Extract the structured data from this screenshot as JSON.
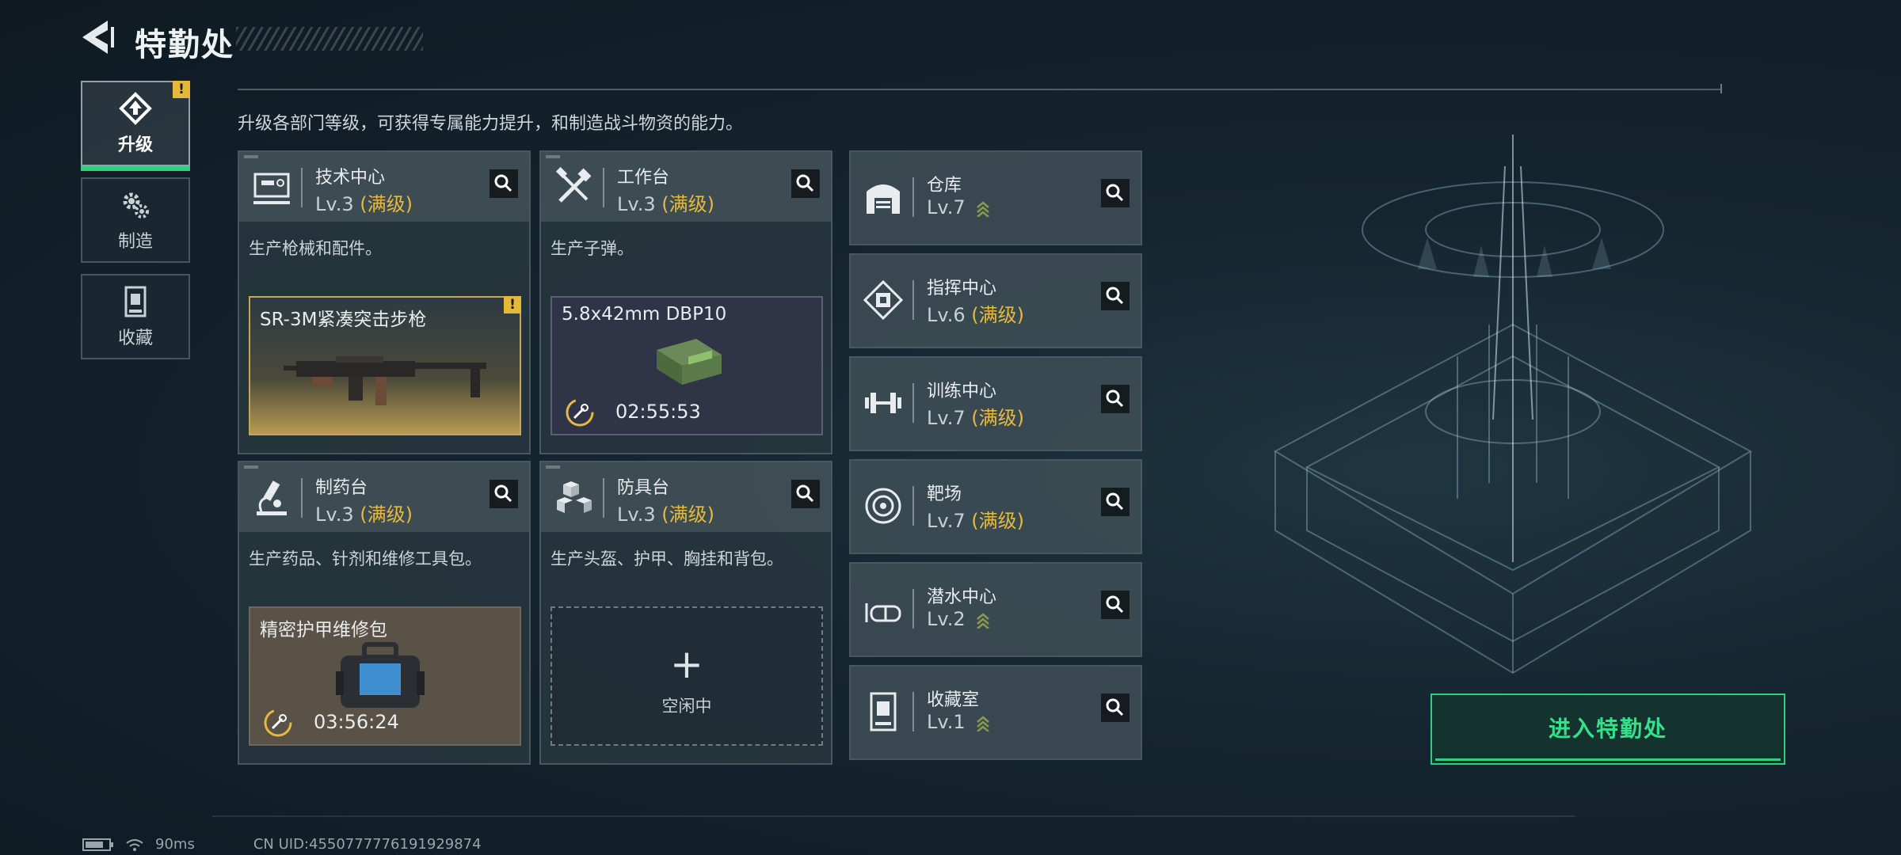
{
  "header": {
    "title": "特勤处"
  },
  "description": "升级各部门等级，可获得专属能力提升，和制造战斗物资的能力。",
  "nav": {
    "items": [
      {
        "label": "升级",
        "active": true,
        "badge": "!"
      },
      {
        "label": "制造"
      },
      {
        "label": "收藏"
      }
    ]
  },
  "cards": [
    {
      "name": "技术中心",
      "level": "Lv.3",
      "max_label": "(满级)",
      "desc": "生产枪械和配件。",
      "slot": {
        "title": "SR-3M紧凑突击步枪",
        "badge": "!"
      }
    },
    {
      "name": "工作台",
      "level": "Lv.3",
      "max_label": "(满级)",
      "desc": "生产子弹。",
      "slot": {
        "title": "5.8x42mm DBP10",
        "time": "02:55:53"
      }
    },
    {
      "name": "制药台",
      "level": "Lv.3",
      "max_label": "(满级)",
      "desc": "生产药品、针剂和维修工具包。",
      "slot": {
        "title": "精密护甲维修包",
        "time": "03:56:24"
      }
    },
    {
      "name": "防具台",
      "level": "Lv.3",
      "max_label": "(满级)",
      "desc": "生产头盔、护甲、胸挂和背包。",
      "slot": {
        "plus": "+",
        "idle_label": "空闲中"
      }
    }
  ],
  "facilities": [
    {
      "name": "仓库",
      "level": "Lv.7",
      "max_label": ""
    },
    {
      "name": "指挥中心",
      "level": "Lv.6",
      "max_label": "(满级)"
    },
    {
      "name": "训练中心",
      "level": "Lv.7",
      "max_label": "(满级)"
    },
    {
      "name": "靶场",
      "level": "Lv.7",
      "max_label": "(满级)"
    },
    {
      "name": "潜水中心",
      "level": "Lv.2",
      "max_label": ""
    },
    {
      "name": "收藏室",
      "level": "Lv.1",
      "max_label": ""
    }
  ],
  "enter_button": "进入特勤处",
  "footer": {
    "ping": "90ms",
    "uid": "CN UID:4550777776191929874"
  },
  "colors": {
    "accent_green": "#2ed07a",
    "max_gold": "#e6b93f",
    "warn_yellow": "#e5b83a"
  }
}
